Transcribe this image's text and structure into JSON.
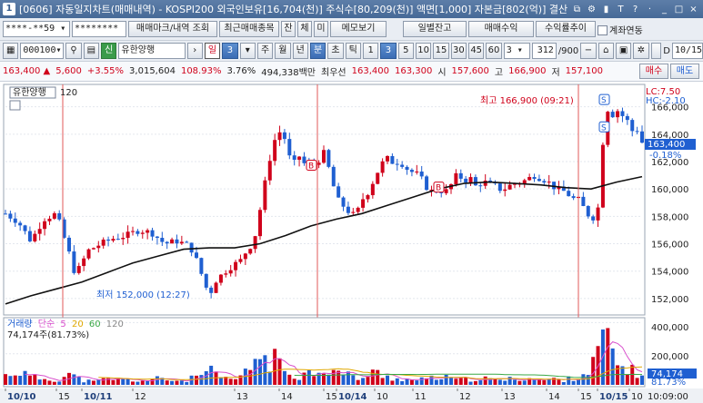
{
  "window": {
    "number": "1",
    "title": "[0606] 자동일지차트(매매내역) - KOSPI200 외국인보유[16,704(천)] 주식수[80,209(천)] 액면[1,000] 자본금[802(억)] 결산"
  },
  "toolbar1": {
    "account": "****-**59",
    "password": "********",
    "trade_mark_button": "매매마크/내역 조회",
    "recent_items_button": "최근매매종목",
    "balance_tabs": [
      "잔",
      "체",
      "미"
    ],
    "memo_button": "메모보기",
    "daily_balance_button": "일별잔고",
    "trade_profit_button": "매매수익",
    "return_trend_button": "수익률추이",
    "account_link_label": "계좌연동"
  },
  "toolbar2": {
    "stock_code": "000100",
    "credit_badge": "신",
    "stock_name": "유한양행",
    "periods": [
      "일",
      "주",
      "월",
      "년",
      "분",
      "초",
      "틱"
    ],
    "period_count": "3",
    "intervals": [
      "1",
      "3",
      "5",
      "10",
      "15",
      "30",
      "45",
      "60"
    ],
    "interval_select": "3",
    "data_count": "312",
    "data_total": "/900",
    "date_label": "D",
    "date_value": "10/15"
  },
  "quote": {
    "price": "163,400",
    "change": "5,600",
    "change_pct": "+3.55%",
    "volume": "3,015,604",
    "vol_ratio": "108.93%",
    "turnover": "3.76%",
    "amount": "494,338백만",
    "best_label": "최우선",
    "best_ask": "163,400",
    "best_bid": "163,300",
    "open_label": "시",
    "open": "157,600",
    "high_label": "고",
    "high": "166,900",
    "low_label": "저",
    "low": "157,100",
    "buy_button": "매수",
    "sell_button": "매도"
  },
  "colors": {
    "up": "#d0021b",
    "down": "#1f5fd1",
    "ma": "#111111",
    "accent": "#3c6db4"
  },
  "chart_data": [
    {
      "type": "candlestick",
      "legend": {
        "name": "유한양행",
        "period": "120"
      },
      "y_ticks": [
        152000,
        154000,
        156000,
        158000,
        160000,
        162000,
        164000,
        166000
      ],
      "y_tick_labels": [
        "152,000",
        "154,000",
        "156,000",
        "158,000",
        "160,000",
        "162,000",
        "164,000",
        "166,000"
      ],
      "ylim": [
        151000,
        167500
      ],
      "last_price": "163,400",
      "last_change": "-0.18%",
      "lc_label": "LC:7.50",
      "hc_label": "HC:-2.10",
      "high_annotation": "최고 166,900 (09:21)",
      "low_annotation": "최저 152,000 (12:27)",
      "trade_marks": [
        {
          "label": "B",
          "x": 0.48,
          "value": 161700
        },
        {
          "label": "B",
          "x": 0.68,
          "value": 160100
        },
        {
          "label": "S",
          "x": 0.94,
          "value": 166500
        },
        {
          "label": "S",
          "x": 0.94,
          "value": 164500
        }
      ],
      "close_path": [
        [
          0.0,
          158200
        ],
        [
          0.02,
          157600
        ],
        [
          0.04,
          156200
        ],
        [
          0.06,
          157800
        ],
        [
          0.08,
          158200
        ],
        [
          0.1,
          155300
        ],
        [
          0.11,
          153700
        ],
        [
          0.13,
          155500
        ],
        [
          0.15,
          156000
        ],
        [
          0.17,
          156400
        ],
        [
          0.19,
          156600
        ],
        [
          0.21,
          157000
        ],
        [
          0.23,
          156800
        ],
        [
          0.25,
          156000
        ],
        [
          0.27,
          156200
        ],
        [
          0.29,
          155800
        ],
        [
          0.3,
          154800
        ],
        [
          0.31,
          153500
        ],
        [
          0.32,
          152200
        ],
        [
          0.33,
          153300
        ],
        [
          0.35,
          154200
        ],
        [
          0.37,
          154800
        ],
        [
          0.38,
          155600
        ],
        [
          0.39,
          156100
        ],
        [
          0.4,
          158500
        ],
        [
          0.41,
          161000
        ],
        [
          0.42,
          163300
        ],
        [
          0.43,
          164200
        ],
        [
          0.44,
          163600
        ],
        [
          0.45,
          161500
        ],
        [
          0.46,
          162500
        ],
        [
          0.47,
          161800
        ],
        [
          0.48,
          161600
        ],
        [
          0.49,
          162000
        ],
        [
          0.5,
          162600
        ],
        [
          0.51,
          161200
        ],
        [
          0.52,
          159300
        ],
        [
          0.53,
          158800
        ],
        [
          0.54,
          158300
        ],
        [
          0.55,
          158000
        ],
        [
          0.56,
          159200
        ],
        [
          0.57,
          159800
        ],
        [
          0.58,
          160800
        ],
        [
          0.59,
          161800
        ],
        [
          0.6,
          162200
        ],
        [
          0.61,
          161900
        ],
        [
          0.62,
          162000
        ],
        [
          0.63,
          161500
        ],
        [
          0.64,
          161200
        ],
        [
          0.65,
          161000
        ],
        [
          0.66,
          160200
        ],
        [
          0.67,
          159800
        ],
        [
          0.68,
          160000
        ],
        [
          0.69,
          159700
        ],
        [
          0.7,
          160300
        ],
        [
          0.71,
          161100
        ],
        [
          0.72,
          160600
        ],
        [
          0.73,
          160800
        ],
        [
          0.74,
          160100
        ],
        [
          0.75,
          160600
        ],
        [
          0.76,
          160300
        ],
        [
          0.77,
          160200
        ],
        [
          0.78,
          159900
        ],
        [
          0.79,
          160200
        ],
        [
          0.8,
          160400
        ],
        [
          0.81,
          160500
        ],
        [
          0.82,
          160700
        ],
        [
          0.83,
          161000
        ],
        [
          0.84,
          160800
        ],
        [
          0.85,
          160600
        ],
        [
          0.86,
          160200
        ],
        [
          0.87,
          159900
        ],
        [
          0.88,
          159800
        ],
        [
          0.89,
          159300
        ],
        [
          0.9,
          159200
        ],
        [
          0.91,
          158500
        ],
        [
          0.92,
          157800
        ],
        [
          0.93,
          158200
        ],
        [
          0.935,
          161000
        ],
        [
          0.94,
          164500
        ],
        [
          0.945,
          166000
        ],
        [
          0.95,
          165200
        ],
        [
          0.96,
          165800
        ],
        [
          0.97,
          165300
        ],
        [
          0.98,
          164800
        ],
        [
          0.985,
          164200
        ],
        [
          0.99,
          164600
        ],
        [
          1.0,
          163400
        ]
      ],
      "ma_path": [
        [
          0.0,
          151600
        ],
        [
          0.04,
          152200
        ],
        [
          0.08,
          152700
        ],
        [
          0.12,
          153200
        ],
        [
          0.16,
          153900
        ],
        [
          0.2,
          154600
        ],
        [
          0.24,
          155100
        ],
        [
          0.28,
          155600
        ],
        [
          0.32,
          155700
        ],
        [
          0.36,
          155700
        ],
        [
          0.4,
          156000
        ],
        [
          0.44,
          156600
        ],
        [
          0.48,
          157300
        ],
        [
          0.52,
          157800
        ],
        [
          0.56,
          158200
        ],
        [
          0.6,
          158800
        ],
        [
          0.64,
          159400
        ],
        [
          0.68,
          160000
        ],
        [
          0.72,
          160400
        ],
        [
          0.76,
          160500
        ],
        [
          0.8,
          160400
        ],
        [
          0.84,
          160300
        ],
        [
          0.88,
          160100
        ],
        [
          0.92,
          160000
        ],
        [
          0.96,
          160500
        ],
        [
          1.0,
          160900
        ]
      ]
    },
    {
      "type": "bar",
      "legend": [
        "거래량",
        "단순",
        "5",
        "20",
        "60",
        "120"
      ],
      "current_volume": "74,174주(81.73%)",
      "y_tick_labels": [
        "400,000",
        "200,000"
      ],
      "last_value": "74,174",
      "last_pct": "81.73%",
      "ylim": [
        0,
        420000
      ],
      "volume_bars": [
        [
          0.0,
          60000
        ],
        [
          0.02,
          90000
        ],
        [
          0.04,
          50000
        ],
        [
          0.06,
          40000
        ],
        [
          0.08,
          30000
        ],
        [
          0.1,
          70000
        ],
        [
          0.12,
          30000
        ],
        [
          0.14,
          20000
        ],
        [
          0.16,
          40000
        ],
        [
          0.18,
          35000
        ],
        [
          0.2,
          30000
        ],
        [
          0.22,
          25000
        ],
        [
          0.24,
          40000
        ],
        [
          0.26,
          30000
        ],
        [
          0.28,
          25000
        ],
        [
          0.3,
          50000
        ],
        [
          0.32,
          90000
        ],
        [
          0.34,
          40000
        ],
        [
          0.36,
          35000
        ],
        [
          0.38,
          80000
        ],
        [
          0.4,
          210000
        ],
        [
          0.41,
          140000
        ],
        [
          0.42,
          170000
        ],
        [
          0.44,
          90000
        ],
        [
          0.46,
          60000
        ],
        [
          0.48,
          80000
        ],
        [
          0.5,
          110000
        ],
        [
          0.52,
          80000
        ],
        [
          0.54,
          60000
        ],
        [
          0.56,
          40000
        ],
        [
          0.58,
          80000
        ],
        [
          0.6,
          50000
        ],
        [
          0.62,
          40000
        ],
        [
          0.64,
          30000
        ],
        [
          0.66,
          35000
        ],
        [
          0.68,
          50000
        ],
        [
          0.7,
          40000
        ],
        [
          0.72,
          30000
        ],
        [
          0.74,
          45000
        ],
        [
          0.76,
          35000
        ],
        [
          0.78,
          30000
        ],
        [
          0.8,
          40000
        ],
        [
          0.82,
          45000
        ],
        [
          0.84,
          30000
        ],
        [
          0.86,
          35000
        ],
        [
          0.88,
          30000
        ],
        [
          0.9,
          60000
        ],
        [
          0.92,
          90000
        ],
        [
          0.935,
          280000
        ],
        [
          0.94,
          330000
        ],
        [
          0.945,
          260000
        ],
        [
          0.95,
          220000
        ],
        [
          0.96,
          140000
        ],
        [
          0.97,
          110000
        ],
        [
          0.98,
          90000
        ],
        [
          1.0,
          74174
        ]
      ]
    }
  ],
  "x_axis": {
    "labels": [
      "10/10",
      "15",
      "10/11",
      "12",
      "13",
      "14",
      "15",
      "10/14",
      "10",
      "11",
      "12",
      "13",
      "14",
      "15",
      "10/15",
      "10"
    ],
    "label_pos": [
      0.0,
      0.08,
      0.12,
      0.2,
      0.36,
      0.43,
      0.5,
      0.52,
      0.58,
      0.64,
      0.71,
      0.78,
      0.85,
      0.9,
      0.93,
      0.98
    ],
    "time": "10:09:00"
  }
}
